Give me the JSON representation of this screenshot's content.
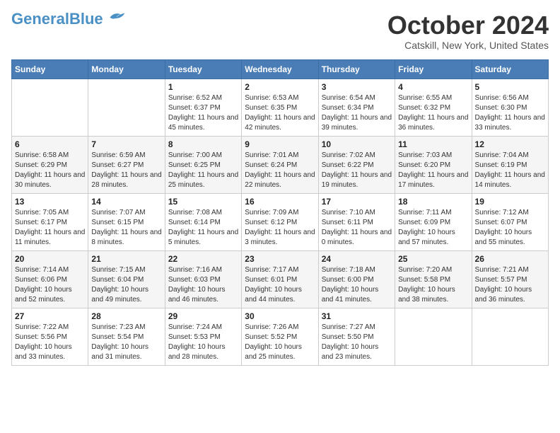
{
  "header": {
    "logo_general": "General",
    "logo_blue": "Blue",
    "month": "October 2024",
    "location": "Catskill, New York, United States"
  },
  "weekdays": [
    "Sunday",
    "Monday",
    "Tuesday",
    "Wednesday",
    "Thursday",
    "Friday",
    "Saturday"
  ],
  "weeks": [
    [
      {
        "day": "",
        "info": ""
      },
      {
        "day": "",
        "info": ""
      },
      {
        "day": "1",
        "info": "Sunrise: 6:52 AM\nSunset: 6:37 PM\nDaylight: 11 hours and 45 minutes."
      },
      {
        "day": "2",
        "info": "Sunrise: 6:53 AM\nSunset: 6:35 PM\nDaylight: 11 hours and 42 minutes."
      },
      {
        "day": "3",
        "info": "Sunrise: 6:54 AM\nSunset: 6:34 PM\nDaylight: 11 hours and 39 minutes."
      },
      {
        "day": "4",
        "info": "Sunrise: 6:55 AM\nSunset: 6:32 PM\nDaylight: 11 hours and 36 minutes."
      },
      {
        "day": "5",
        "info": "Sunrise: 6:56 AM\nSunset: 6:30 PM\nDaylight: 11 hours and 33 minutes."
      }
    ],
    [
      {
        "day": "6",
        "info": "Sunrise: 6:58 AM\nSunset: 6:29 PM\nDaylight: 11 hours and 30 minutes."
      },
      {
        "day": "7",
        "info": "Sunrise: 6:59 AM\nSunset: 6:27 PM\nDaylight: 11 hours and 28 minutes."
      },
      {
        "day": "8",
        "info": "Sunrise: 7:00 AM\nSunset: 6:25 PM\nDaylight: 11 hours and 25 minutes."
      },
      {
        "day": "9",
        "info": "Sunrise: 7:01 AM\nSunset: 6:24 PM\nDaylight: 11 hours and 22 minutes."
      },
      {
        "day": "10",
        "info": "Sunrise: 7:02 AM\nSunset: 6:22 PM\nDaylight: 11 hours and 19 minutes."
      },
      {
        "day": "11",
        "info": "Sunrise: 7:03 AM\nSunset: 6:20 PM\nDaylight: 11 hours and 17 minutes."
      },
      {
        "day": "12",
        "info": "Sunrise: 7:04 AM\nSunset: 6:19 PM\nDaylight: 11 hours and 14 minutes."
      }
    ],
    [
      {
        "day": "13",
        "info": "Sunrise: 7:05 AM\nSunset: 6:17 PM\nDaylight: 11 hours and 11 minutes."
      },
      {
        "day": "14",
        "info": "Sunrise: 7:07 AM\nSunset: 6:15 PM\nDaylight: 11 hours and 8 minutes."
      },
      {
        "day": "15",
        "info": "Sunrise: 7:08 AM\nSunset: 6:14 PM\nDaylight: 11 hours and 5 minutes."
      },
      {
        "day": "16",
        "info": "Sunrise: 7:09 AM\nSunset: 6:12 PM\nDaylight: 11 hours and 3 minutes."
      },
      {
        "day": "17",
        "info": "Sunrise: 7:10 AM\nSunset: 6:11 PM\nDaylight: 11 hours and 0 minutes."
      },
      {
        "day": "18",
        "info": "Sunrise: 7:11 AM\nSunset: 6:09 PM\nDaylight: 10 hours and 57 minutes."
      },
      {
        "day": "19",
        "info": "Sunrise: 7:12 AM\nSunset: 6:07 PM\nDaylight: 10 hours and 55 minutes."
      }
    ],
    [
      {
        "day": "20",
        "info": "Sunrise: 7:14 AM\nSunset: 6:06 PM\nDaylight: 10 hours and 52 minutes."
      },
      {
        "day": "21",
        "info": "Sunrise: 7:15 AM\nSunset: 6:04 PM\nDaylight: 10 hours and 49 minutes."
      },
      {
        "day": "22",
        "info": "Sunrise: 7:16 AM\nSunset: 6:03 PM\nDaylight: 10 hours and 46 minutes."
      },
      {
        "day": "23",
        "info": "Sunrise: 7:17 AM\nSunset: 6:01 PM\nDaylight: 10 hours and 44 minutes."
      },
      {
        "day": "24",
        "info": "Sunrise: 7:18 AM\nSunset: 6:00 PM\nDaylight: 10 hours and 41 minutes."
      },
      {
        "day": "25",
        "info": "Sunrise: 7:20 AM\nSunset: 5:58 PM\nDaylight: 10 hours and 38 minutes."
      },
      {
        "day": "26",
        "info": "Sunrise: 7:21 AM\nSunset: 5:57 PM\nDaylight: 10 hours and 36 minutes."
      }
    ],
    [
      {
        "day": "27",
        "info": "Sunrise: 7:22 AM\nSunset: 5:56 PM\nDaylight: 10 hours and 33 minutes."
      },
      {
        "day": "28",
        "info": "Sunrise: 7:23 AM\nSunset: 5:54 PM\nDaylight: 10 hours and 31 minutes."
      },
      {
        "day": "29",
        "info": "Sunrise: 7:24 AM\nSunset: 5:53 PM\nDaylight: 10 hours and 28 minutes."
      },
      {
        "day": "30",
        "info": "Sunrise: 7:26 AM\nSunset: 5:52 PM\nDaylight: 10 hours and 25 minutes."
      },
      {
        "day": "31",
        "info": "Sunrise: 7:27 AM\nSunset: 5:50 PM\nDaylight: 10 hours and 23 minutes."
      },
      {
        "day": "",
        "info": ""
      },
      {
        "day": "",
        "info": ""
      }
    ]
  ]
}
